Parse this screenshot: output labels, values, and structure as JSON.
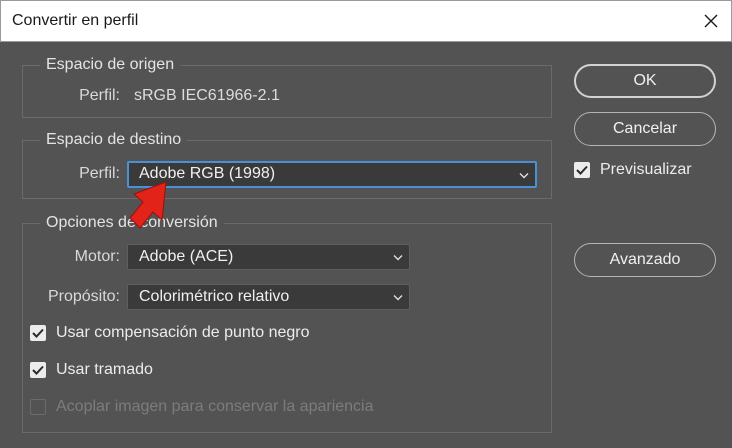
{
  "dialog": {
    "title": "Convertir en perfil",
    "close_icon": "close-icon"
  },
  "source_space": {
    "legend": "Espacio de origen",
    "profile_label": "Perfil:",
    "profile_value": "sRGB IEC61966-2.1"
  },
  "destination_space": {
    "legend": "Espacio de destino",
    "profile_label": "Perfil:",
    "profile_selected": "Adobe RGB (1998)"
  },
  "conversion_options": {
    "legend": "Opciones de conversión",
    "engine_label": "Motor:",
    "engine_selected": "Adobe (ACE)",
    "intent_label": "Propósito:",
    "intent_selected": "Colorimétrico relativo",
    "black_point_label": "Usar compensación de punto negro",
    "black_point_checked": true,
    "dither_label": "Usar tramado",
    "dither_checked": true,
    "flatten_label": "Acoplar imagen para conservar la apariencia",
    "flatten_checked": false,
    "flatten_disabled": true
  },
  "buttons": {
    "ok": "OK",
    "cancel": "Cancelar",
    "advanced": "Avanzado"
  },
  "preview": {
    "label": "Previsualizar",
    "checked": true
  },
  "colors": {
    "dialog_bg": "#535353",
    "focus_border": "#4a8fd8",
    "annotation_arrow": "#e2231a"
  }
}
